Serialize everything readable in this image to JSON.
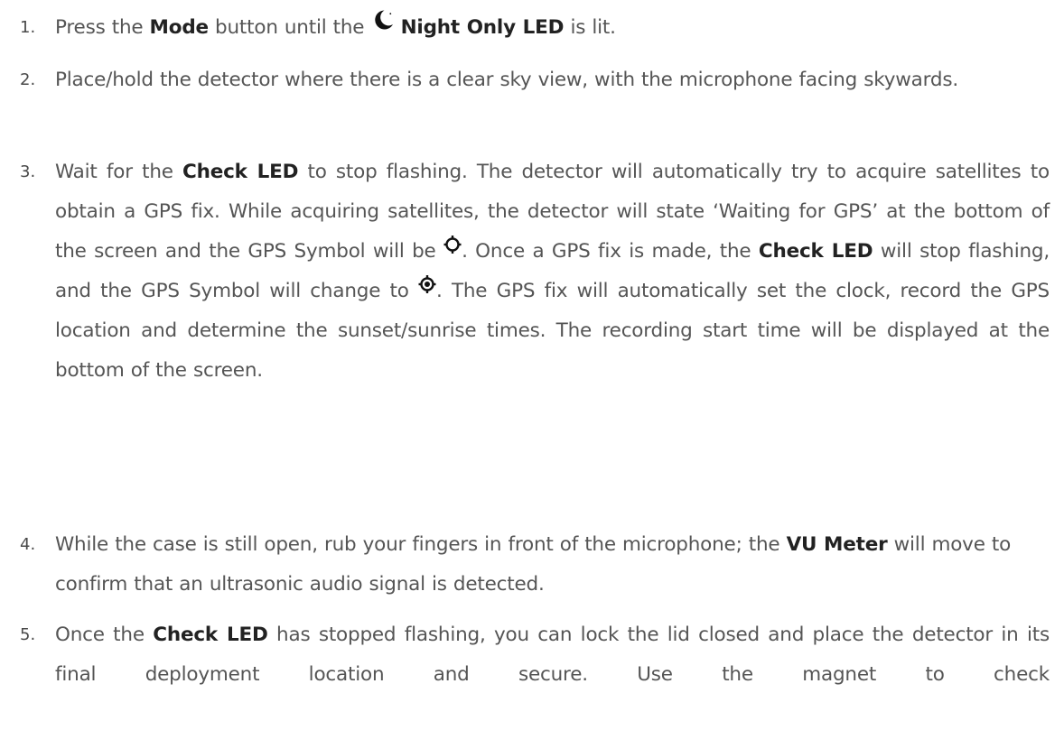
{
  "steps": [
    {
      "number": "1.",
      "parts": {
        "p1": "Press the ",
        "b1": "Mode",
        "p2": " button until the ",
        "b2": "Night Only LED",
        "p3": " is lit."
      },
      "icon": "moon-stars-icon"
    },
    {
      "number": "2.",
      "text": "Place/hold the detector where there is a clear sky view, with the microphone facing skywards."
    },
    {
      "number": "3.",
      "parts": {
        "p1": "Wait for the ",
        "b1": "Check LED",
        "p2": " to stop flashing. The detector will automatically try to acquire satellites to obtain a GPS fix. While acquiring satellites, the detector will state ‘Waiting for GPS’ at the bottom of the screen and the GPS Symbol will be ",
        "p3": ". Once a GPS fix is made, the ",
        "b2": "Check LED",
        "p4": " will stop flashing, and the GPS Symbol will change to ",
        "p5": ". The GPS fix will automatically set the clock, record the GPS location and determine the sunset/sunrise times. The recording start time will be displayed at the bottom of the screen."
      },
      "icons": [
        "gps-searching-icon",
        "gps-fixed-icon"
      ]
    },
    {
      "number": "4.",
      "parts": {
        "p1": "While the case is still open, rub your fingers in front of the microphone; the ",
        "b1": "VU Meter",
        "p2": " will move to confirm that an ultrasonic audio signal is detected."
      }
    },
    {
      "number": "5.",
      "parts": {
        "p1": "Once the ",
        "b1": "Check LED",
        "p2": " has stopped flashing, you can lock the lid closed and place the detector in its final deployment location and secure. Use the magnet to check"
      }
    }
  ]
}
